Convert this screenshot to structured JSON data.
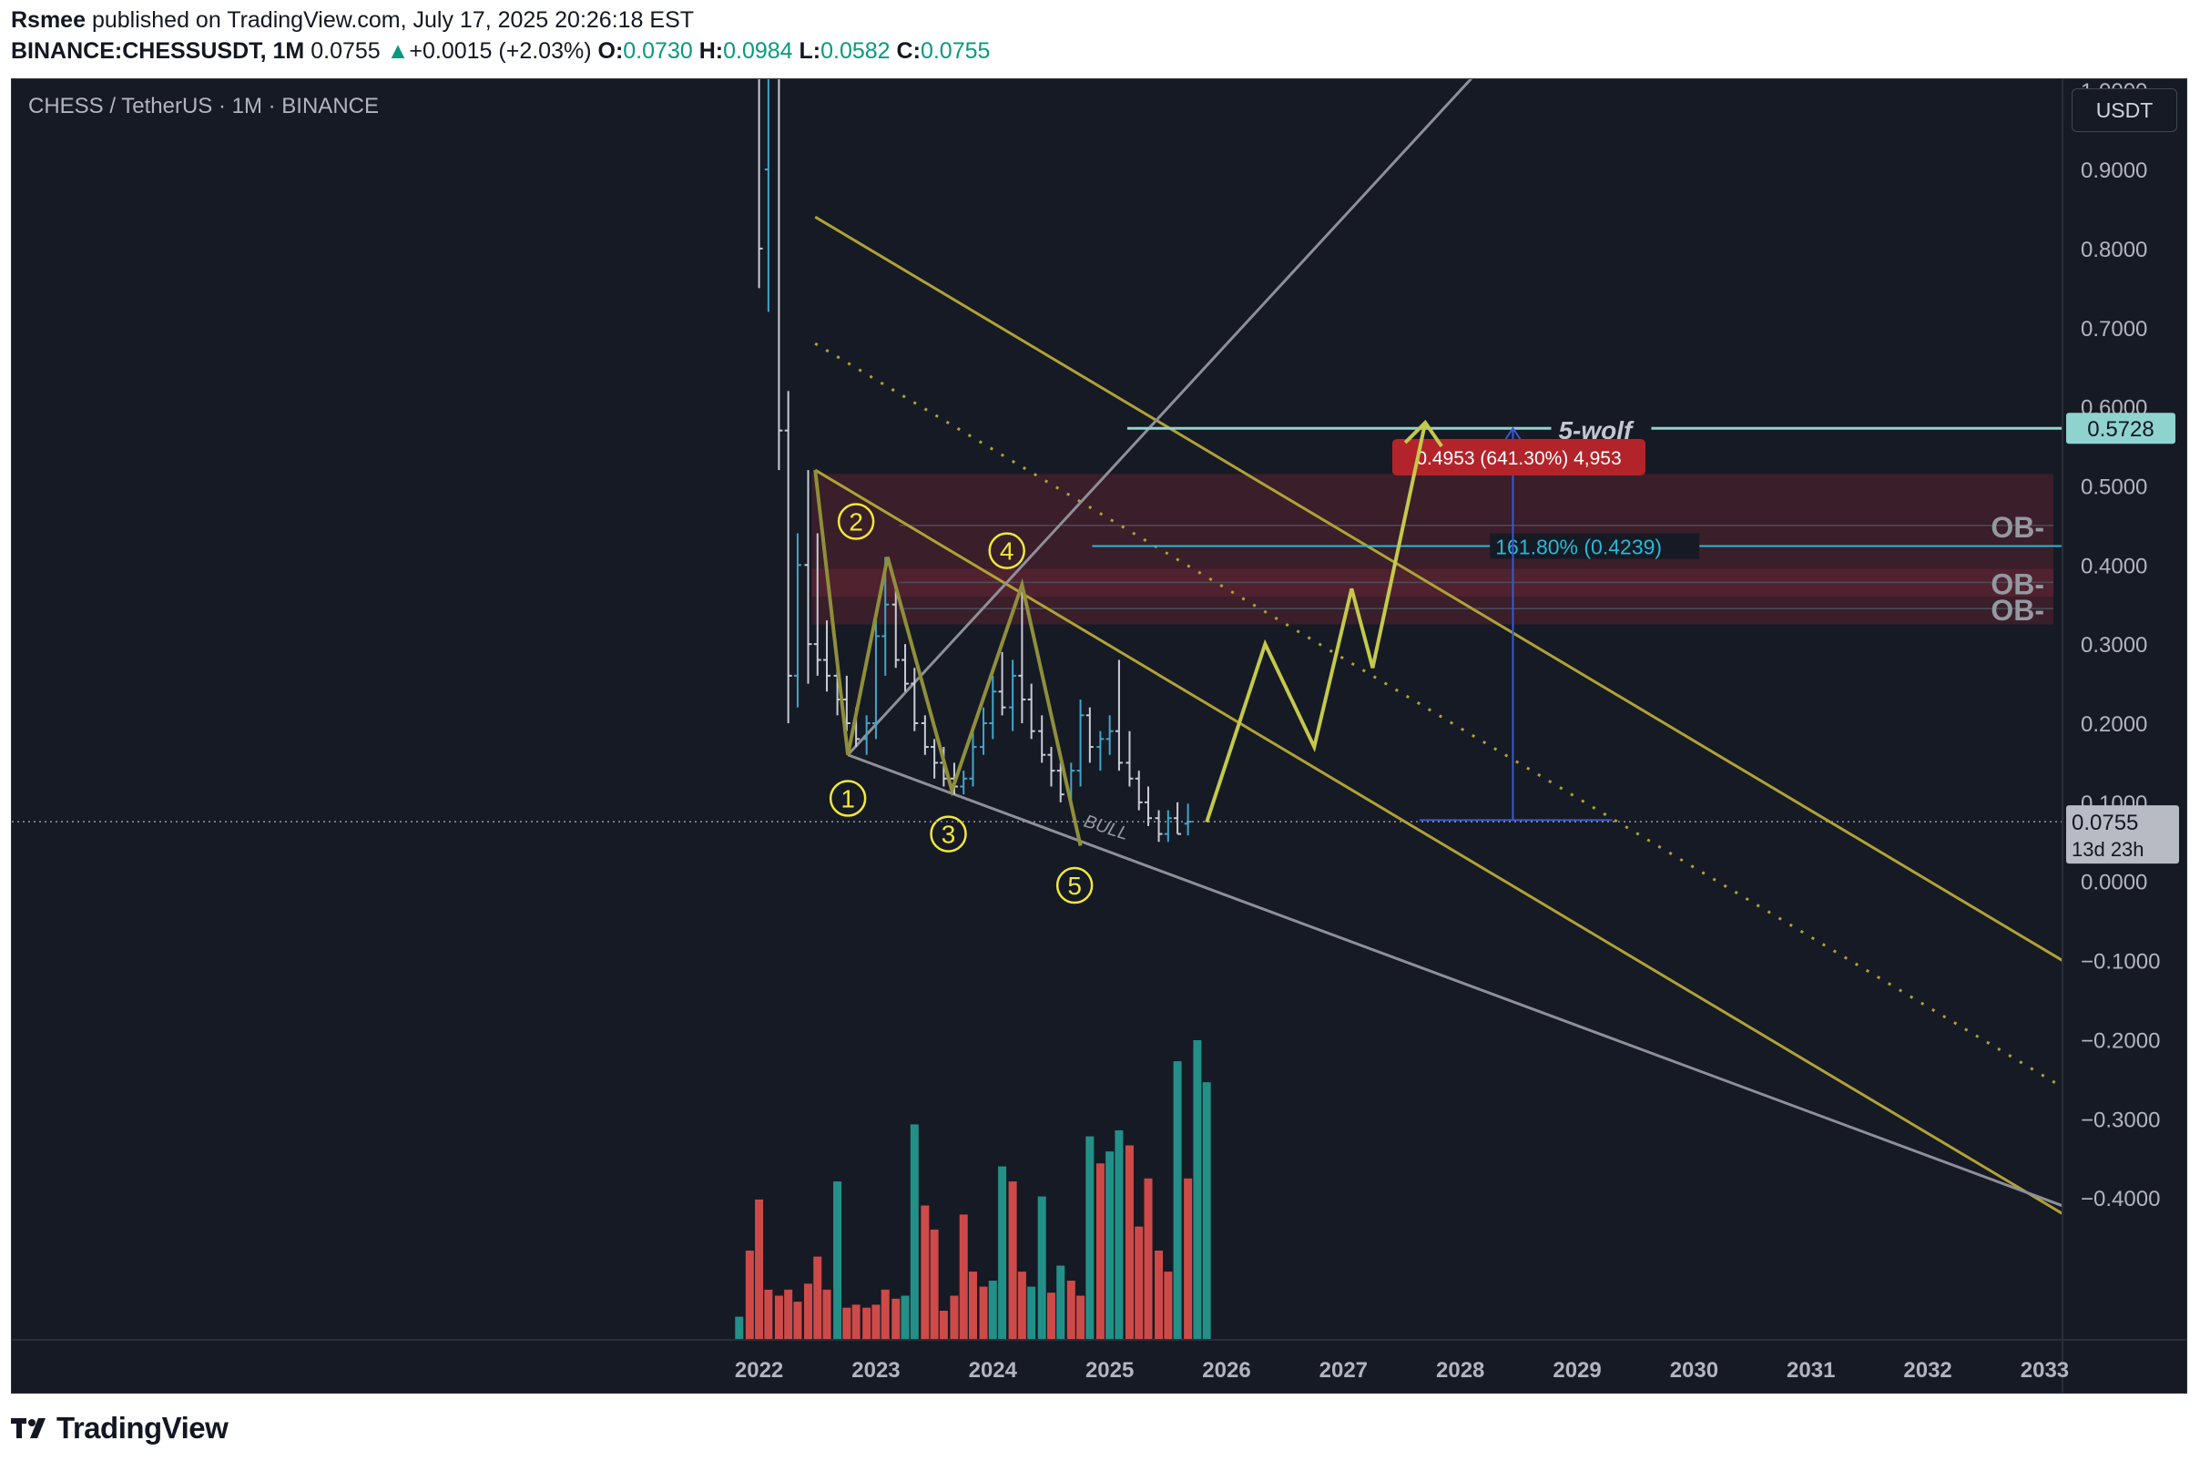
{
  "header": {
    "author": "Rsmee",
    "published_text": " published on TradingView.com, July 17, 2025 20:26:18 EST",
    "symbol": "BINANCE:CHESSUSDT, 1M",
    "last": "0.0755",
    "change": "+0.0015 (+2.03%)",
    "o_label": "O:",
    "o_value": "0.0730",
    "h_label": "H:",
    "h_value": "0.0984",
    "l_label": "L:",
    "l_value": "0.0582",
    "c_label": "C:",
    "c_value": "0.0755"
  },
  "legend_title": "CHESS / TetherUS · 1M · BINANCE",
  "currency": "USDT",
  "footer": {
    "brand": "TradingView"
  },
  "colors": {
    "background": "#161a25",
    "up": "#26a69a",
    "down": "#ef5350",
    "channel": "#b0a235",
    "wolf": "#c4c94a",
    "grey_line": "#8f8f97",
    "target_line": "#8fd3cf",
    "fib": "#2ab8d6",
    "ob_zone": "#5a2230",
    "badge": "#b2242a"
  },
  "chart_data": {
    "type": "candlestick",
    "title": "CHESS / TetherUS · 1M · BINANCE",
    "y_axis": {
      "range": [
        -0.45,
        1.08
      ],
      "ticks": [
        "1.0000",
        "0.9000",
        "0.8000",
        "0.7000",
        "0.6000",
        "0.5000",
        "0.4000",
        "0.3000",
        "0.2000",
        "0.1000",
        "0.0000",
        "−0.1000",
        "−0.2000",
        "−0.3000",
        "−0.4000"
      ],
      "tick_values": [
        1.0,
        0.9,
        0.8,
        0.7,
        0.6,
        0.5,
        0.4,
        0.3,
        0.2,
        0.1,
        0.0,
        -0.1,
        -0.2,
        -0.3,
        -0.4
      ]
    },
    "x_axis": {
      "ticks": [
        "2022",
        "2023",
        "2024",
        "2025",
        "2026",
        "2027",
        "2028",
        "2029",
        "2030",
        "2031",
        "2032",
        "2033"
      ],
      "tick_values": [
        2022,
        2023,
        2024,
        2025,
        2026,
        2027,
        2028,
        2029,
        2030,
        2031,
        2032,
        2033
      ],
      "range": [
        2016.3,
        2033.2
      ]
    },
    "grid": false,
    "price_labels": {
      "target": "0.5728",
      "current": "0.0755",
      "countdown": "13d 23h",
      "target_value": 0.5728,
      "current_value": 0.0755
    },
    "candles": [
      {
        "t": 2022.0,
        "o": 1.1,
        "h": 1.2,
        "l": 0.75,
        "c": 0.8
      },
      {
        "t": 2022.08,
        "o": 0.9,
        "h": 1.1,
        "l": 0.72,
        "c": 1.05
      },
      {
        "t": 2022.17,
        "o": 1.05,
        "h": 1.1,
        "l": 0.52,
        "c": 0.57
      },
      {
        "t": 2022.25,
        "o": 0.57,
        "h": 0.62,
        "l": 0.2,
        "c": 0.26
      },
      {
        "t": 2022.33,
        "o": 0.26,
        "h": 0.44,
        "l": 0.22,
        "c": 0.4
      },
      {
        "t": 2022.42,
        "o": 0.4,
        "h": 0.52,
        "l": 0.25,
        "c": 0.3
      },
      {
        "t": 2022.5,
        "o": 0.3,
        "h": 0.44,
        "l": 0.26,
        "c": 0.28
      },
      {
        "t": 2022.58,
        "o": 0.28,
        "h": 0.33,
        "l": 0.24,
        "c": 0.26
      },
      {
        "t": 2022.67,
        "o": 0.26,
        "h": 0.27,
        "l": 0.21,
        "c": 0.23
      },
      {
        "t": 2022.75,
        "o": 0.23,
        "h": 0.26,
        "l": 0.19,
        "c": 0.2
      },
      {
        "t": 2022.83,
        "o": 0.2,
        "h": 0.22,
        "l": 0.17,
        "c": 0.18
      },
      {
        "t": 2022.92,
        "o": 0.18,
        "h": 0.21,
        "l": 0.16,
        "c": 0.2
      },
      {
        "t": 2023.0,
        "o": 0.2,
        "h": 0.34,
        "l": 0.18,
        "c": 0.31
      },
      {
        "t": 2023.08,
        "o": 0.31,
        "h": 0.41,
        "l": 0.26,
        "c": 0.35
      },
      {
        "t": 2023.17,
        "o": 0.35,
        "h": 0.37,
        "l": 0.27,
        "c": 0.28
      },
      {
        "t": 2023.25,
        "o": 0.28,
        "h": 0.3,
        "l": 0.24,
        "c": 0.25
      },
      {
        "t": 2023.33,
        "o": 0.25,
        "h": 0.27,
        "l": 0.19,
        "c": 0.2
      },
      {
        "t": 2023.42,
        "o": 0.2,
        "h": 0.21,
        "l": 0.16,
        "c": 0.17
      },
      {
        "t": 2023.5,
        "o": 0.17,
        "h": 0.18,
        "l": 0.13,
        "c": 0.15
      },
      {
        "t": 2023.58,
        "o": 0.15,
        "h": 0.17,
        "l": 0.12,
        "c": 0.13
      },
      {
        "t": 2023.67,
        "o": 0.13,
        "h": 0.15,
        "l": 0.11,
        "c": 0.12
      },
      {
        "t": 2023.75,
        "o": 0.12,
        "h": 0.14,
        "l": 0.11,
        "c": 0.13
      },
      {
        "t": 2023.83,
        "o": 0.13,
        "h": 0.19,
        "l": 0.12,
        "c": 0.17
      },
      {
        "t": 2023.92,
        "o": 0.17,
        "h": 0.22,
        "l": 0.16,
        "c": 0.2
      },
      {
        "t": 2024.0,
        "o": 0.2,
        "h": 0.26,
        "l": 0.18,
        "c": 0.24
      },
      {
        "t": 2024.08,
        "o": 0.24,
        "h": 0.29,
        "l": 0.21,
        "c": 0.22
      },
      {
        "t": 2024.17,
        "o": 0.22,
        "h": 0.28,
        "l": 0.19,
        "c": 0.26
      },
      {
        "t": 2024.25,
        "o": 0.26,
        "h": 0.37,
        "l": 0.2,
        "c": 0.23
      },
      {
        "t": 2024.33,
        "o": 0.23,
        "h": 0.25,
        "l": 0.18,
        "c": 0.19
      },
      {
        "t": 2024.42,
        "o": 0.19,
        "h": 0.21,
        "l": 0.15,
        "c": 0.16
      },
      {
        "t": 2024.5,
        "o": 0.16,
        "h": 0.17,
        "l": 0.12,
        "c": 0.14
      },
      {
        "t": 2024.58,
        "o": 0.14,
        "h": 0.15,
        "l": 0.1,
        "c": 0.11
      },
      {
        "t": 2024.67,
        "o": 0.11,
        "h": 0.15,
        "l": 0.1,
        "c": 0.14
      },
      {
        "t": 2024.75,
        "o": 0.14,
        "h": 0.23,
        "l": 0.12,
        "c": 0.21
      },
      {
        "t": 2024.83,
        "o": 0.21,
        "h": 0.22,
        "l": 0.15,
        "c": 0.17
      },
      {
        "t": 2024.92,
        "o": 0.17,
        "h": 0.19,
        "l": 0.14,
        "c": 0.18
      },
      {
        "t": 2025.0,
        "o": 0.18,
        "h": 0.21,
        "l": 0.16,
        "c": 0.19
      },
      {
        "t": 2025.08,
        "o": 0.19,
        "h": 0.28,
        "l": 0.14,
        "c": 0.15
      },
      {
        "t": 2025.17,
        "o": 0.15,
        "h": 0.19,
        "l": 0.12,
        "c": 0.13
      },
      {
        "t": 2025.25,
        "o": 0.13,
        "h": 0.14,
        "l": 0.09,
        "c": 0.1
      },
      {
        "t": 2025.33,
        "o": 0.1,
        "h": 0.12,
        "l": 0.07,
        "c": 0.08
      },
      {
        "t": 2025.42,
        "o": 0.08,
        "h": 0.09,
        "l": 0.05,
        "c": 0.06
      },
      {
        "t": 2025.5,
        "o": 0.06,
        "h": 0.09,
        "l": 0.05,
        "c": 0.08
      },
      {
        "t": 2025.58,
        "o": 0.08,
        "h": 0.1,
        "l": 0.06,
        "c": 0.06
      },
      {
        "t": 2025.67,
        "o": 0.073,
        "h": 0.0984,
        "l": 0.0582,
        "c": 0.0755
      }
    ],
    "volume_bars": [
      {
        "t": 2021.83,
        "v": 0.08,
        "up": true
      },
      {
        "t": 2021.92,
        "v": 0.3,
        "up": false
      },
      {
        "t": 2022.0,
        "v": 0.47,
        "up": false
      },
      {
        "t": 2022.08,
        "v": 0.17,
        "up": false
      },
      {
        "t": 2022.17,
        "v": 0.15,
        "up": false
      },
      {
        "t": 2022.25,
        "v": 0.17,
        "up": false
      },
      {
        "t": 2022.33,
        "v": 0.13,
        "up": false
      },
      {
        "t": 2022.42,
        "v": 0.19,
        "up": false
      },
      {
        "t": 2022.5,
        "v": 0.28,
        "up": false
      },
      {
        "t": 2022.58,
        "v": 0.17,
        "up": false
      },
      {
        "t": 2022.67,
        "v": 0.53,
        "up": true
      },
      {
        "t": 2022.75,
        "v": 0.11,
        "up": false
      },
      {
        "t": 2022.83,
        "v": 0.12,
        "up": false
      },
      {
        "t": 2022.92,
        "v": 0.11,
        "up": false
      },
      {
        "t": 2023.0,
        "v": 0.12,
        "up": false
      },
      {
        "t": 2023.08,
        "v": 0.17,
        "up": false
      },
      {
        "t": 2023.17,
        "v": 0.14,
        "up": false
      },
      {
        "t": 2023.25,
        "v": 0.15,
        "up": true
      },
      {
        "t": 2023.33,
        "v": 0.72,
        "up": true
      },
      {
        "t": 2023.42,
        "v": 0.45,
        "up": false
      },
      {
        "t": 2023.5,
        "v": 0.37,
        "up": false
      },
      {
        "t": 2023.58,
        "v": 0.1,
        "up": false
      },
      {
        "t": 2023.67,
        "v": 0.15,
        "up": false
      },
      {
        "t": 2023.75,
        "v": 0.42,
        "up": false
      },
      {
        "t": 2023.83,
        "v": 0.23,
        "up": false
      },
      {
        "t": 2023.92,
        "v": 0.18,
        "up": false
      },
      {
        "t": 2024.0,
        "v": 0.2,
        "up": true
      },
      {
        "t": 2024.08,
        "v": 0.58,
        "up": true
      },
      {
        "t": 2024.17,
        "v": 0.53,
        "up": false
      },
      {
        "t": 2024.25,
        "v": 0.23,
        "up": false
      },
      {
        "t": 2024.33,
        "v": 0.18,
        "up": true
      },
      {
        "t": 2024.42,
        "v": 0.48,
        "up": true
      },
      {
        "t": 2024.5,
        "v": 0.16,
        "up": false
      },
      {
        "t": 2024.58,
        "v": 0.25,
        "up": true
      },
      {
        "t": 2024.67,
        "v": 0.2,
        "up": false
      },
      {
        "t": 2024.75,
        "v": 0.15,
        "up": false
      },
      {
        "t": 2024.83,
        "v": 0.68,
        "up": true
      },
      {
        "t": 2024.92,
        "v": 0.59,
        "up": false
      },
      {
        "t": 2025.0,
        "v": 0.63,
        "up": true
      },
      {
        "t": 2025.08,
        "v": 0.7,
        "up": true
      },
      {
        "t": 2025.17,
        "v": 0.65,
        "up": false
      },
      {
        "t": 2025.25,
        "v": 0.38,
        "up": false
      },
      {
        "t": 2025.33,
        "v": 0.54,
        "up": false
      },
      {
        "t": 2025.42,
        "v": 0.3,
        "up": false
      },
      {
        "t": 2025.5,
        "v": 0.23,
        "up": false
      },
      {
        "t": 2025.58,
        "v": 0.93,
        "up": true
      },
      {
        "t": 2025.67,
        "v": 0.54,
        "up": false
      },
      {
        "t": 2025.75,
        "v": 1.0,
        "up": true
      },
      {
        "t": 2025.83,
        "v": 0.86,
        "up": true
      }
    ],
    "annotations": {
      "wolfe_points": [
        {
          "label": "①",
          "t": 2022.76,
          "y": 0.16
        },
        {
          "label": "②",
          "t": 2023.1,
          "y": 0.41
        },
        {
          "label": "③",
          "t": 2023.65,
          "y": 0.115
        },
        {
          "label": "④",
          "t": 2024.25,
          "y": 0.375
        },
        {
          "label": "⑤",
          "t": 2024.75,
          "y": 0.045
        }
      ],
      "wave_labels": [
        {
          "text": "①",
          "t": 2022.76,
          "y": 0.105
        },
        {
          "text": "②",
          "t": 2022.83,
          "y": 0.455
        },
        {
          "text": "③",
          "t": 2023.62,
          "y": 0.06
        },
        {
          "text": "④",
          "t": 2024.12,
          "y": 0.418
        },
        {
          "text": "⑤",
          "t": 2024.7,
          "y": -0.005
        }
      ],
      "zigzag_start": {
        "t": 2022.48,
        "y": 0.52
      },
      "projection_path": [
        {
          "t": 2025.83,
          "y": 0.075
        },
        {
          "t": 2026.33,
          "y": 0.3
        },
        {
          "t": 2026.75,
          "y": 0.17
        },
        {
          "t": 2027.07,
          "y": 0.37
        },
        {
          "t": 2027.25,
          "y": 0.27
        },
        {
          "t": 2027.7,
          "y": 0.58
        }
      ],
      "target_label": "5-wolf",
      "target_y": 0.5728,
      "target_from_t": 2025.15,
      "fib_label": "161.80% (0.4239)",
      "fib_y": 0.4239,
      "fib_from_t": 2024.85,
      "ob_label": "OB-",
      "ob_lines": [
        0.45,
        0.378,
        0.345
      ],
      "ob_zone": [
        0.325,
        0.515
      ],
      "measure_badge": "0.4953 (641.30%) 4,953",
      "measure_from": 0.0775,
      "measure_to": 0.5728,
      "measure_t": 2028.45,
      "bull_label": "BULL",
      "bull_at": {
        "t": 2024.77,
        "y": 0.07
      }
    }
  }
}
